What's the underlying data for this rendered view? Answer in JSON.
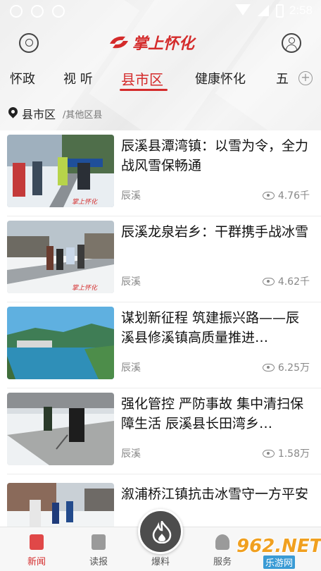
{
  "status_bar": {
    "time": "2:58"
  },
  "header": {
    "logo_text": "掌上怀化"
  },
  "tabs": [
    {
      "label": "怀政"
    },
    {
      "label": "视 听"
    },
    {
      "label": "县市区"
    },
    {
      "label": "健康怀化"
    },
    {
      "label": "五"
    }
  ],
  "active_tab": "县市区",
  "location": {
    "current": "县市区",
    "other": "/其他区县"
  },
  "news": [
    {
      "title": "辰溪县潭湾镇：以雪为令，全力战风雪保畅通",
      "source": "辰溪",
      "views": "4.76千"
    },
    {
      "title": "辰溪龙泉岩乡：干群携手战冰雪",
      "source": "辰溪",
      "views": "4.62千"
    },
    {
      "title": "谋划新征程 筑建振兴路——辰溪县修溪镇高质量推进…",
      "source": "辰溪",
      "views": "6.25万"
    },
    {
      "title": "强化管控 严防事故 集中清扫保障生活 辰溪县长田湾乡…",
      "source": "辰溪",
      "views": "1.58万"
    },
    {
      "title": "溆浦桥江镇抗击冰雪守一方平安",
      "source": "",
      "views": ""
    }
  ],
  "bottom_nav": [
    {
      "label": "新闻"
    },
    {
      "label": "读报"
    },
    {
      "label": "爆料"
    },
    {
      "label": "服务"
    }
  ],
  "watermark": {
    "text": "962.NET",
    "sub": "乐游网"
  },
  "colors": {
    "accent": "#d42b2b",
    "fab": "#4d4d4d"
  }
}
